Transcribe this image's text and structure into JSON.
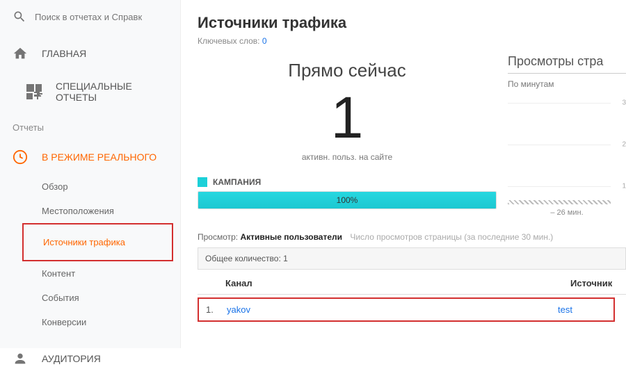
{
  "sidebar": {
    "search_placeholder": "Поиск в отчетах и Справк",
    "home": "ГЛАВНАЯ",
    "special": "СПЕЦИАЛЬНЫЕ ОТЧЕТЫ",
    "reports_label": "Отчеты",
    "realtime": "В РЕЖИМЕ РЕАЛЬНОГО",
    "sub": {
      "overview": "Обзор",
      "locations": "Местоположения",
      "traffic_sources": "Источники трафика",
      "content": "Контент",
      "events": "События",
      "conversions": "Конверсии"
    },
    "audience": "АУДИТОРИЯ"
  },
  "main": {
    "title": "Источники трафика",
    "keywords_label": "Ключевых слов:",
    "keywords_count": "0",
    "right_now": "Прямо сейчас",
    "big_number": "1",
    "active_caption": "активн. польз. на сайте",
    "campaign_label": "КАМПАНИЯ",
    "bar_percent": "100%",
    "pageviews_title": "Просмотры стра",
    "per_minute": "По минутам",
    "xlabel": "– 26 мин.",
    "viewmode_label": "Просмотр:",
    "viewmode_active": "Активные пользователи",
    "viewmode_dim": "Число просмотров страницы (за последние 30 мин.)",
    "total_label": "Общее количество:",
    "total_value": "1",
    "col_channel": "Канал",
    "col_source": "Источник",
    "rows": [
      {
        "idx": "1.",
        "channel": "yakov",
        "source": "test"
      }
    ]
  },
  "chart_data": {
    "type": "bar",
    "title": "Просмотры страниц — По минутам",
    "xlabel": "– 26 мин.",
    "ylabel": "",
    "ylim": [
      0,
      3
    ],
    "yticks": [
      1,
      2,
      3
    ],
    "categories_minutes_ago": [
      26
    ],
    "values": [
      0
    ]
  }
}
